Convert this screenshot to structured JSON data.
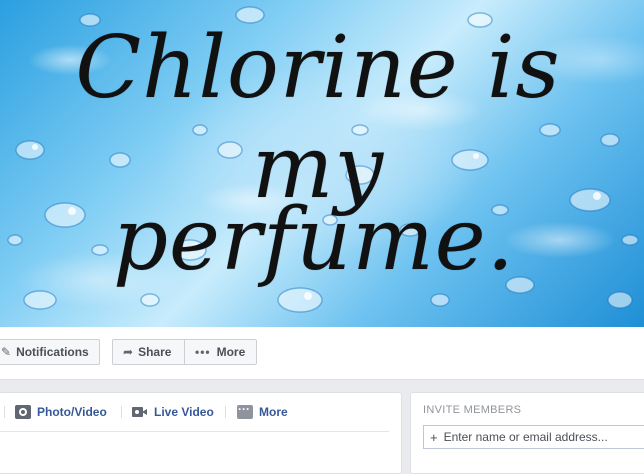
{
  "cover": {
    "line1": "Chlorine is my",
    "line2": "perfume."
  },
  "actionbar": {
    "notifications_label": "Notifications",
    "share_label": "Share",
    "more_label": "More",
    "notifications_icon": "pencil-icon",
    "share_icon": "share-arrow-icon",
    "more_icon": "ellipsis-icon"
  },
  "composer": {
    "tabs": [
      {
        "label": "Photo/Video",
        "icon": "camera-icon"
      },
      {
        "label": "Live Video",
        "icon": "video-camera-icon"
      },
      {
        "label": "More",
        "icon": "ellipsis-icon"
      }
    ]
  },
  "invite": {
    "title": "INVITE MEMBERS",
    "placeholder": "Enter name or email address..."
  },
  "colors": {
    "link_blue": "#365899",
    "page_bg": "#e9ebee",
    "cover_blue": "#2a9fe0"
  }
}
